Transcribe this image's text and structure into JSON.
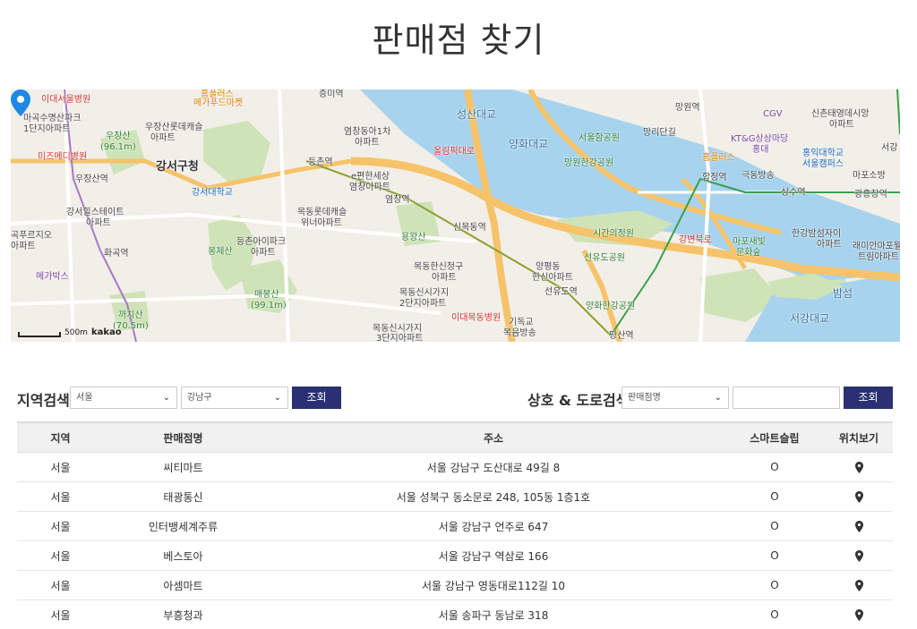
{
  "page": {
    "title": "판매점 찾기"
  },
  "map": {
    "labels": {
      "l01": "이대서울병원",
      "l02": "마곡수명산파크",
      "l03": "1단지아파트",
      "l04": "미즈메디병원",
      "l05": "우장산역",
      "l06": "우장산",
      "l07": "(96.1m)",
      "l08": "우장산롯데캐슬",
      "l09": "아파트",
      "l10": "강서구청",
      "l11": "강서대학교",
      "l12": "강서힐스테이트",
      "l13": "아파트",
      "l14": "곡푸르지오",
      "l15": "아파트",
      "l16": "화곡역",
      "l17": "메가박스",
      "l18": "봉제산",
      "l19": "등촌아이파크",
      "l20": "아파트",
      "l21": "매봉산",
      "l22": "(99.1m)",
      "l23": "까치산",
      "l24": "(70.5m)",
      "l25": "홈플러스",
      "l26": "메가푸드마켓",
      "l27": "증미역",
      "l28": "등촌역",
      "l29": "염창동아1차",
      "l30": "아파트",
      "l31": "e편한세상",
      "l32": "염창아파트",
      "l33": "염창역",
      "l34": "목동롯데캐슬",
      "l35": "위너아파트",
      "l36": "용왕산",
      "l37": "신목동역",
      "l38": "목동한신청구",
      "l39": "아파트",
      "l40": "목동신시가지",
      "l41": "2단지아파트",
      "l42": "이대목동병원",
      "l43": "목동신시가지",
      "l44": "3단지아파트",
      "l45": "올림픽대로",
      "l46": "양평동",
      "l47": "한신아파트",
      "l48": "선유도역",
      "l49": "기독교",
      "l50": "복음방송",
      "l51": "서울함공원",
      "l52": "망원한강공원",
      "l53": "망원역",
      "l54": "망리단길",
      "l55": "홈플러스",
      "l56": "합정역",
      "l57": "극동방송",
      "l58": "시간의정원",
      "l59": "선유도공원",
      "l60": "양화한강공원",
      "l61": "당산역",
      "l62": "강변북로",
      "l63": "상수역",
      "l64": "마포새빛",
      "l65": "문화숲",
      "l66": "KT&G상상마당",
      "l67": "홍대",
      "l68": "CGV",
      "l69": "신촌태영데시앙",
      "l70": "아파트",
      "l71": "홍익대학교",
      "l72": "서울캠퍼스",
      "l73": "마포소방",
      "l74": "광흥창역",
      "l75": "한강밤섬자이",
      "l76": "아파트",
      "l77": "래미안마포웰",
      "l78": "트림아파트",
      "l79": "밤섬",
      "l80": "서강대교",
      "l81": "양화대교",
      "l82": "성산대교",
      "l83": "서강"
    },
    "scale_label": "500m",
    "logo": "kakao",
    "colors": {
      "water": "#a7d3ee",
      "land": "#f2efe8",
      "park": "#cfe3b8",
      "highway": "#f6c36a",
      "road": "#ffffff",
      "pin": "#1e88e5"
    }
  },
  "search": {
    "region": {
      "title": "지역검색",
      "city": "서울",
      "district": "강남구",
      "button": "조회"
    },
    "store": {
      "title": "상호 & 도로검색",
      "type": "판매점명",
      "query": "",
      "button": "조회"
    }
  },
  "table": {
    "headers": {
      "region": "지역",
      "name": "판매점명",
      "address": "주소",
      "smart": "스마트슬립",
      "location": "위치보기"
    },
    "rows": [
      {
        "region": "서울",
        "name": "씨티마트",
        "address": "서울 강남구 도산대로 49길 8",
        "smart": "O"
      },
      {
        "region": "서울",
        "name": "태광통신",
        "address": "서울 성북구 동소문로 248, 105동 1층1호",
        "smart": "O"
      },
      {
        "region": "서울",
        "name": "인터뱅세계주류",
        "address": "서울 강남구 언주로 647",
        "smart": "O"
      },
      {
        "region": "서울",
        "name": "베스토아",
        "address": "서울 강남구 역삼로 166",
        "smart": "O"
      },
      {
        "region": "서울",
        "name": "아셈마트",
        "address": "서울 강남구 영동대로112길 10",
        "smart": "O"
      },
      {
        "region": "서울",
        "name": "부흥청과",
        "address": "서울 송파구 동남로 318",
        "smart": "O"
      }
    ]
  }
}
